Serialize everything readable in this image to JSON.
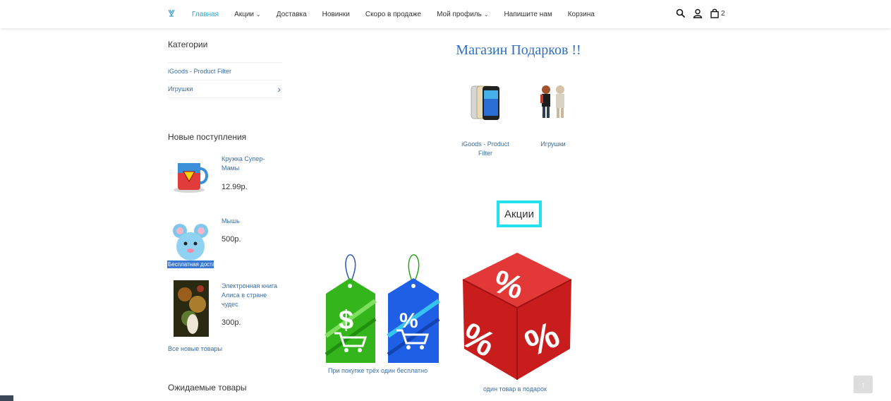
{
  "header": {
    "nav": [
      {
        "label": "Главная",
        "active": true,
        "dropdown": false
      },
      {
        "label": "Акции",
        "active": false,
        "dropdown": true
      },
      {
        "label": "Доставка",
        "active": false,
        "dropdown": false
      },
      {
        "label": "Новинки",
        "active": false,
        "dropdown": false
      },
      {
        "label": "Скоро в продаже",
        "active": false,
        "dropdown": false
      },
      {
        "label": "Мой профиль",
        "active": false,
        "dropdown": true
      },
      {
        "label": "Напишите нам",
        "active": false,
        "dropdown": false
      },
      {
        "label": "Корзина",
        "active": false,
        "dropdown": false
      }
    ],
    "cart_count": "2",
    "accent": "#2aa7d6"
  },
  "sidebar": {
    "categories_title": "Категории",
    "categories": [
      {
        "label": "iGoods - Product Filter",
        "has_children": false
      },
      {
        "label": "Игрушки",
        "has_children": true
      }
    ],
    "new_title": "Новые поступления",
    "products": [
      {
        "name": "Кружка Супер-Мамы",
        "price": "12.99р."
      },
      {
        "name": "Мышь",
        "price": "500р.",
        "badge": "Бесплатная доставка"
      },
      {
        "name": "Электронная книга Алиса в стране чудес",
        "price": "300р."
      }
    ],
    "all_new": "Все новые товары",
    "expected_title": "Ожидаемые товары"
  },
  "main": {
    "title": "Магазин Подарков !!",
    "category_cards": [
      {
        "label": "iGoods - Product Filter"
      },
      {
        "label": "Игрушки"
      }
    ],
    "promo_title": "Акции",
    "promos": [
      {
        "label": "При покупке трёх один бесплатно"
      },
      {
        "label": "один товар в подарок"
      }
    ]
  },
  "icons": [
    "logo-icon",
    "chevron-down-icon",
    "search-icon",
    "user-icon",
    "shopping-bag-icon",
    "chevron-right-icon",
    "arrow-up-icon"
  ]
}
